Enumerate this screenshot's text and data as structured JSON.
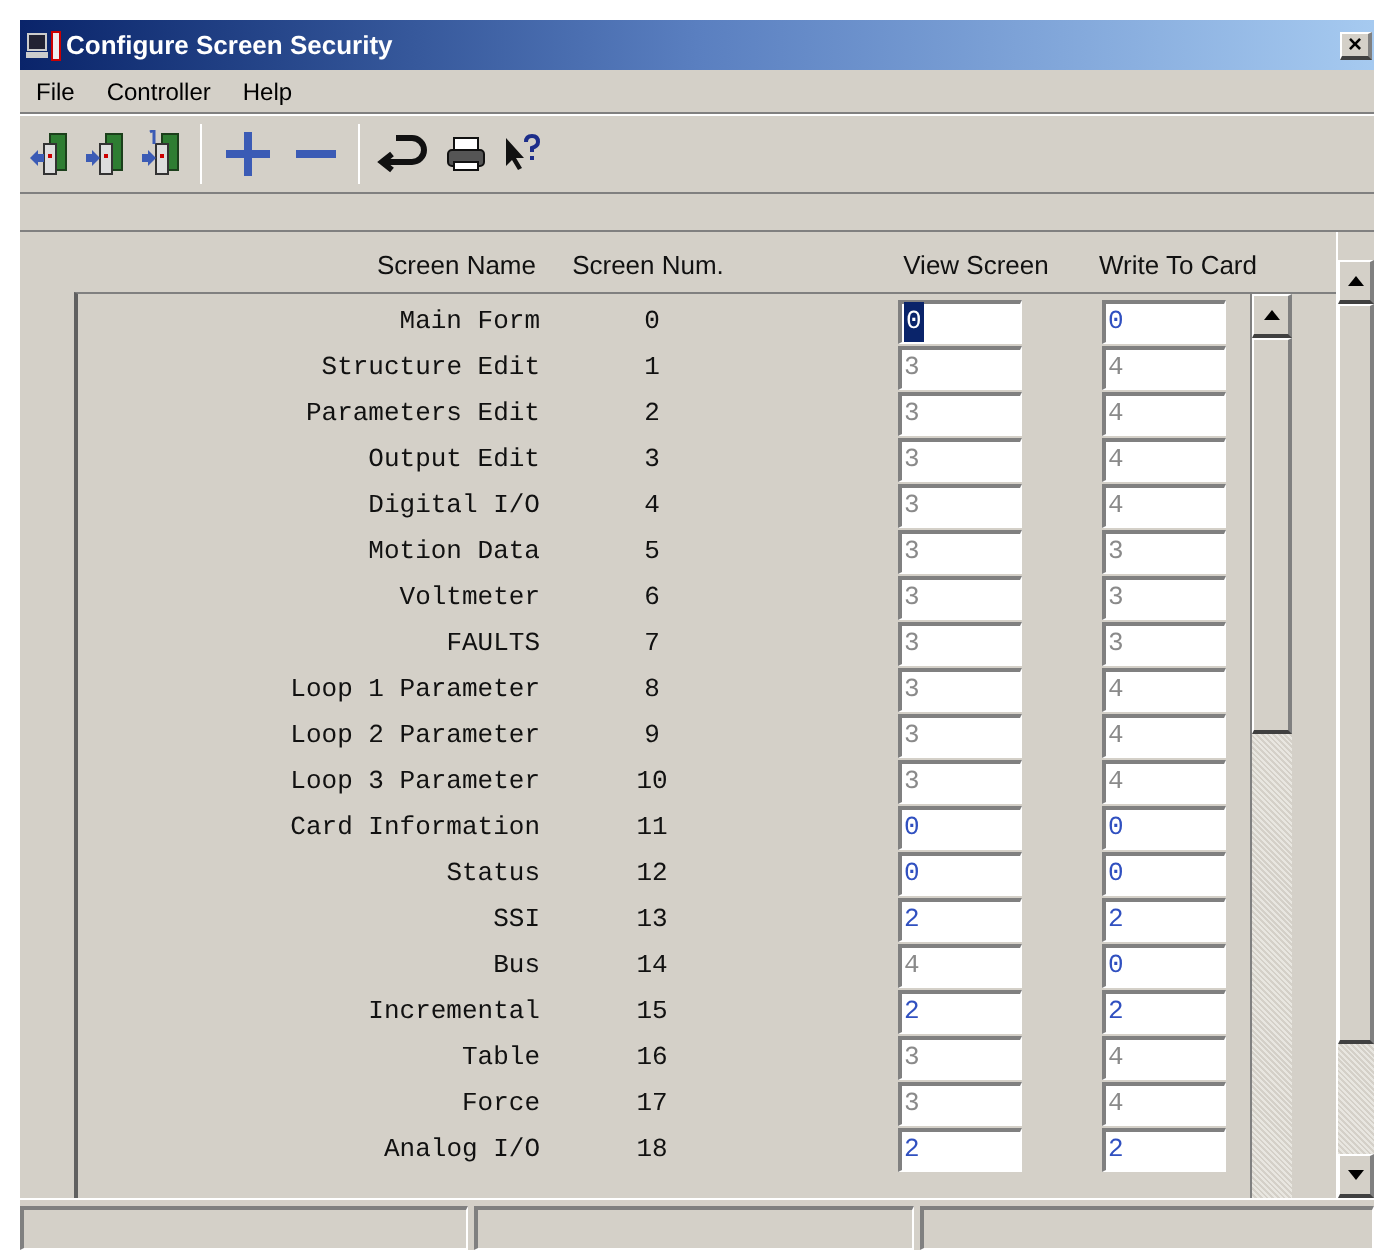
{
  "window": {
    "title": "Configure Screen Security",
    "close": "×"
  },
  "menu": [
    "File",
    "Controller",
    "Help"
  ],
  "columns": [
    "Screen Name",
    "Screen Num.",
    "View Screen",
    "Write To Card"
  ],
  "rows": [
    {
      "name": "Main Form",
      "num": "0",
      "view": {
        "value": "0",
        "active": true,
        "focused": true
      },
      "write": {
        "value": "0",
        "active": true,
        "focused": false
      }
    },
    {
      "name": "Structure Edit",
      "num": "1",
      "view": {
        "value": "3",
        "active": false,
        "focused": false
      },
      "write": {
        "value": "4",
        "active": false,
        "focused": false
      }
    },
    {
      "name": "Parameters Edit",
      "num": "2",
      "view": {
        "value": "3",
        "active": false,
        "focused": false
      },
      "write": {
        "value": "4",
        "active": false,
        "focused": false
      }
    },
    {
      "name": "Output Edit",
      "num": "3",
      "view": {
        "value": "3",
        "active": false,
        "focused": false
      },
      "write": {
        "value": "4",
        "active": false,
        "focused": false
      }
    },
    {
      "name": "Digital I/O",
      "num": "4",
      "view": {
        "value": "3",
        "active": false,
        "focused": false
      },
      "write": {
        "value": "4",
        "active": false,
        "focused": false
      }
    },
    {
      "name": "Motion Data",
      "num": "5",
      "view": {
        "value": "3",
        "active": false,
        "focused": false
      },
      "write": {
        "value": "3",
        "active": false,
        "focused": false
      }
    },
    {
      "name": "Voltmeter",
      "num": "6",
      "view": {
        "value": "3",
        "active": false,
        "focused": false
      },
      "write": {
        "value": "3",
        "active": false,
        "focused": false
      }
    },
    {
      "name": "FAULTS",
      "num": "7",
      "view": {
        "value": "3",
        "active": false,
        "focused": false
      },
      "write": {
        "value": "3",
        "active": false,
        "focused": false
      }
    },
    {
      "name": "Loop 1 Parameter",
      "num": "8",
      "view": {
        "value": "3",
        "active": false,
        "focused": false
      },
      "write": {
        "value": "4",
        "active": false,
        "focused": false
      }
    },
    {
      "name": "Loop 2 Parameter",
      "num": "9",
      "view": {
        "value": "3",
        "active": false,
        "focused": false
      },
      "write": {
        "value": "4",
        "active": false,
        "focused": false
      }
    },
    {
      "name": "Loop 3 Parameter",
      "num": "10",
      "view": {
        "value": "3",
        "active": false,
        "focused": false
      },
      "write": {
        "value": "4",
        "active": false,
        "focused": false
      }
    },
    {
      "name": "Card Information",
      "num": "11",
      "view": {
        "value": "0",
        "active": true,
        "focused": false
      },
      "write": {
        "value": "0",
        "active": true,
        "focused": false
      }
    },
    {
      "name": "Status",
      "num": "12",
      "view": {
        "value": "0",
        "active": true,
        "focused": false
      },
      "write": {
        "value": "0",
        "active": true,
        "focused": false
      }
    },
    {
      "name": "SSI",
      "num": "13",
      "view": {
        "value": "2",
        "active": true,
        "focused": false
      },
      "write": {
        "value": "2",
        "active": true,
        "focused": false
      }
    },
    {
      "name": "Bus",
      "num": "14",
      "view": {
        "value": "4",
        "active": false,
        "focused": false
      },
      "write": {
        "value": "0",
        "active": true,
        "focused": false
      }
    },
    {
      "name": "Incremental",
      "num": "15",
      "view": {
        "value": "2",
        "active": true,
        "focused": false
      },
      "write": {
        "value": "2",
        "active": true,
        "focused": false
      }
    },
    {
      "name": "Table",
      "num": "16",
      "view": {
        "value": "3",
        "active": false,
        "focused": false
      },
      "write": {
        "value": "4",
        "active": false,
        "focused": false
      }
    },
    {
      "name": "Force",
      "num": "17",
      "view": {
        "value": "3",
        "active": false,
        "focused": false
      },
      "write": {
        "value": "4",
        "active": false,
        "focused": false
      }
    },
    {
      "name": "Analog I/O",
      "num": "18",
      "view": {
        "value": "2",
        "active": true,
        "focused": false
      },
      "write": {
        "value": "2",
        "active": true,
        "focused": false
      }
    }
  ]
}
